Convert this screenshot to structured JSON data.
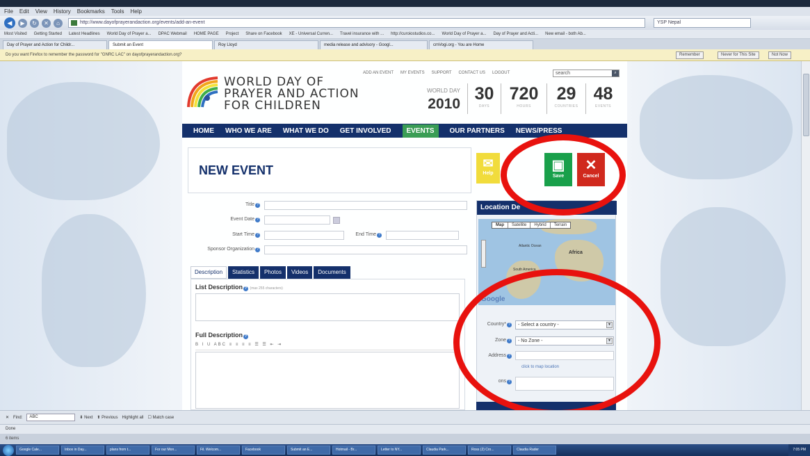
{
  "browser": {
    "menu": [
      "File",
      "Edit",
      "View",
      "History",
      "Bookmarks",
      "Tools",
      "Help"
    ],
    "url": "http://www.dayofprayerandaction.org/events/add-an-event",
    "search_engine": "YSP Nepal",
    "bookmarks": [
      "Most Visited",
      "Getting Started",
      "Latest Headlines",
      "World Day of Prayer a...",
      "DPAC Webmail",
      "HOME PAGE",
      "Project",
      "Share on Facebook",
      "XE - Universal Curren...",
      "Travel insurance with ...",
      "http://curoiostudios.co...",
      "World Day of Prayer a...",
      "Day of Prayer and Acti...",
      "New email - both Ab..."
    ],
    "tabs": [
      {
        "label": "Day of Prayer and Action for Childr...",
        "active": false
      },
      {
        "label": "Submit an Event",
        "active": true
      },
      {
        "label": "Roy Lloyd",
        "active": false
      },
      {
        "label": "media release and advisory - Googl...",
        "active": false
      },
      {
        "label": "cmVogi.org - You are Home",
        "active": false
      }
    ],
    "password_prompt": "Do you want Firefox to remember the password for \"GNRC LAC\" on dayofprayerandaction.org?",
    "password_buttons": {
      "remember": "Remember",
      "never": "Never for This Site",
      "not_now": "Not Now"
    },
    "find_label": "Find:",
    "find_value": "ABC",
    "find_next": "Next",
    "find_previous": "Previous",
    "highlight_all": "Highlight all",
    "match_case": "Match case",
    "status": "Done",
    "below_status": "6 items"
  },
  "site": {
    "logo_line1": "WORLD DAY OF",
    "logo_line2": "PRAYER AND ACTION",
    "logo_line3": "FOR CHILDREN",
    "top_links": [
      "ADD AN EVENT",
      "MY EVENTS",
      "SUPPORT",
      "CONTACT US",
      "LOGOUT"
    ],
    "search_placeholder": "search",
    "world_day_label": "WORLD DAY",
    "world_day_year": "2010",
    "stats": [
      {
        "num": "30",
        "label": "DAYS"
      },
      {
        "num": "720",
        "label": "HOURS"
      },
      {
        "num": "29",
        "label": "COUNTRIES"
      },
      {
        "num": "48",
        "label": "EVENTS"
      }
    ],
    "nav": [
      {
        "label": "HOME",
        "active": false
      },
      {
        "label": "WHO WE ARE",
        "active": false
      },
      {
        "label": "WHAT WE DO",
        "active": false
      },
      {
        "label": "GET INVOLVED",
        "active": false
      },
      {
        "label": "EVENTS",
        "active": true
      },
      {
        "label": "OUR PARTNERS",
        "active": false
      },
      {
        "label": "NEWS/PRESS",
        "active": false
      }
    ],
    "page_title": "NEW EVENT",
    "help_label": "Help",
    "save_label": "Save",
    "cancel_label": "Cancel",
    "form": {
      "title_label": "Title",
      "event_date_label": "Event Date",
      "start_time_label": "Start Time",
      "end_time_label": "End Time",
      "sponsor_label": "Sponsor Organization"
    },
    "desc_tabs": [
      "Description",
      "Statistics",
      "Photos",
      "Videos",
      "Documents"
    ],
    "list_desc_label": "List Description",
    "list_desc_note": "(max 255 characters)",
    "full_desc_label": "Full Description",
    "location": {
      "heading": "Location De",
      "map_types": [
        "Map",
        "Satellite",
        "Hybrid",
        "Terrain"
      ],
      "map_labels": [
        "Atlantic Ocean",
        "Africa",
        "South America"
      ],
      "google": "Google",
      "country_label": "Country*",
      "country_value": "- Select a country -",
      "zone_label": "Zone",
      "zone_value": "- No Zone -",
      "address_label": "Address",
      "map_link": "click to map location",
      "extra_label": "ons"
    }
  },
  "taskbar": {
    "items": [
      "Google Cale...",
      "Inbox in Day...",
      "plans from t...",
      "For our Mon...",
      "Fil. Welcom...",
      "Facebook",
      "Submit an E...",
      "Hotmail - Br...",
      "Letter to NY...",
      "Claudia Park...",
      "Ross (2) Cro...",
      "Claudia Rader"
    ],
    "clock": "7:05 PM"
  }
}
